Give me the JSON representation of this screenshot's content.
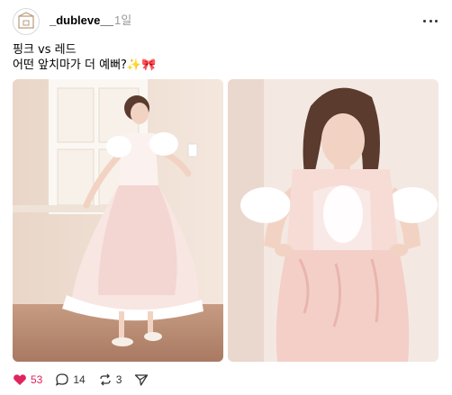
{
  "post": {
    "username": "_dubleve__",
    "time": "1일",
    "caption_line1": "핑크 vs 레드",
    "caption_line2": "어떤 앞치마가 더 예뻐?✨🎀",
    "images": [
      {
        "icon": "photo-pink-dress-window"
      },
      {
        "icon": "photo-pink-dress-closeup"
      }
    ],
    "actions": {
      "likes": "53",
      "comments": "14",
      "reposts": "3"
    },
    "colors": {
      "like": "#e0245e",
      "muted": "#999999"
    }
  }
}
